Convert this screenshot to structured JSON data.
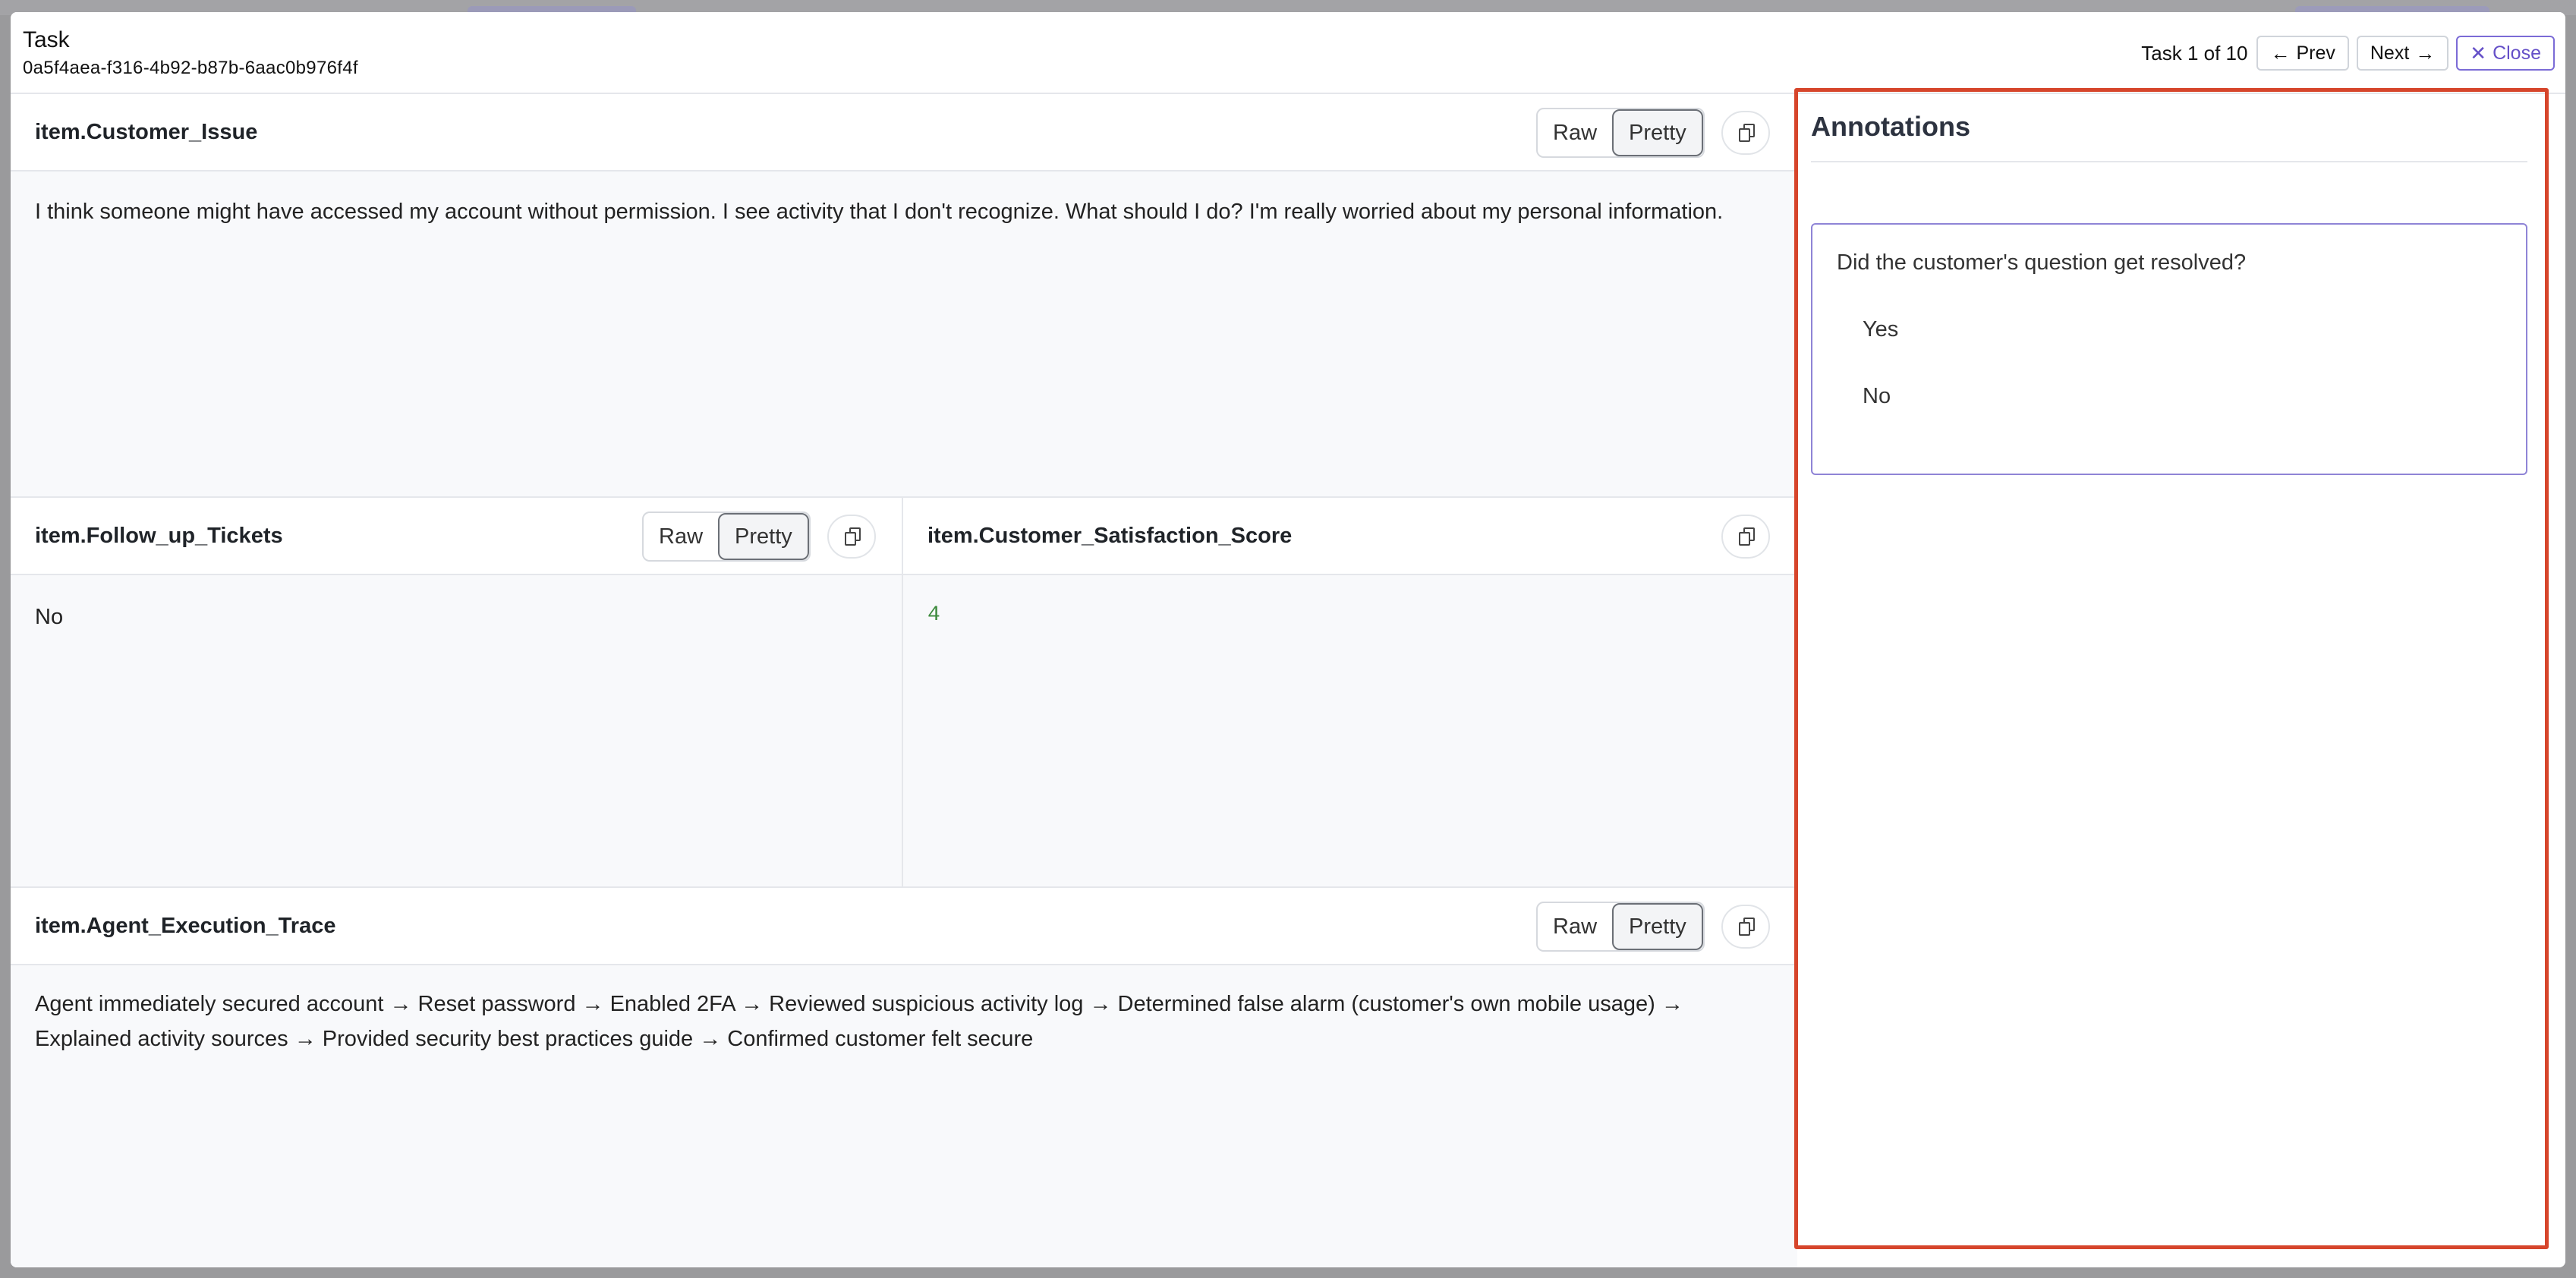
{
  "header": {
    "title": "Task",
    "task_id": "0a5f4aea-f316-4b92-b87b-6aac0b976f4f",
    "task_count": "Task 1 of 10",
    "prev_label": "Prev",
    "next_label": "Next",
    "close_label": "Close"
  },
  "panels": {
    "customer_issue": {
      "title": "item.Customer_Issue",
      "raw_label": "Raw",
      "pretty_label": "Pretty",
      "content": "I think someone might have accessed my account without permission. I see activity that I don't recognize. What should I do? I'm really worried about my personal information."
    },
    "follow_up_tickets": {
      "title": "item.Follow_up_Tickets",
      "raw_label": "Raw",
      "pretty_label": "Pretty",
      "content": "No"
    },
    "satisfaction_score": {
      "title": "item.Customer_Satisfaction_Score",
      "content": "4"
    },
    "agent_trace": {
      "title": "item.Agent_Execution_Trace",
      "raw_label": "Raw",
      "pretty_label": "Pretty",
      "content": "Agent immediately secured account → Reset password → Enabled 2FA → Reviewed suspicious activity log → Determined false alarm (customer's own mobile usage) → Explained activity sources → Provided security best practices guide → Confirmed customer felt secure"
    }
  },
  "annotations": {
    "title": "Annotations",
    "question": "Did the customer's question get resolved?",
    "options": [
      "Yes",
      "No"
    ]
  },
  "colors": {
    "accent": "#6550c8",
    "highlight_outline": "#d6452b",
    "score_green": "#3d8b3d"
  }
}
